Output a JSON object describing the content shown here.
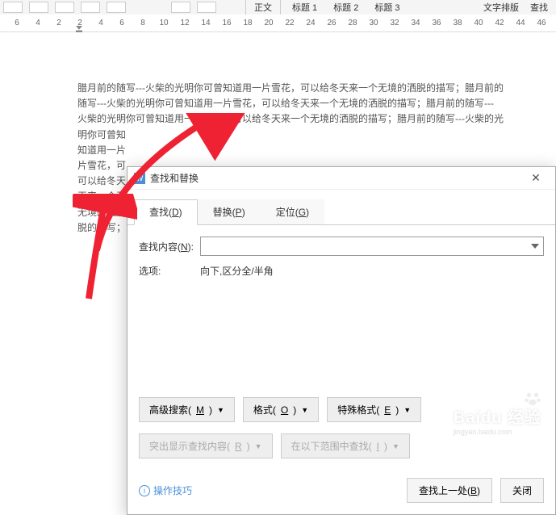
{
  "toolbar": {
    "styles": [
      "正文",
      "标题 1",
      "标题 2",
      "标题 3"
    ],
    "layout": "文字排版",
    "find": "查找"
  },
  "ruler": {
    "ticks": [
      "6",
      "4",
      "2",
      "2",
      "4",
      "6",
      "8",
      "10",
      "12",
      "14",
      "16",
      "18",
      "20",
      "22",
      "24",
      "26",
      "28",
      "30",
      "32",
      "34",
      "36",
      "38",
      "40",
      "42",
      "44",
      "46"
    ]
  },
  "doc": {
    "line1": "腊月前的随写---火柴的光明你可曾知道用一片雪花，可以给冬天来一个无境的洒脱的描写；腊月前的",
    "line2": "随写---火柴的光明你可曾知道用一片雪花，可以给冬天来一个无境的洒脱的描写；腊月前的随写---",
    "line3": "火柴的光明你可曾知道用一片雪花，可以给冬天来一个无境的洒脱的描写；腊月前的随写---火柴的光",
    "line4": "明你可曾知",
    "line5": "知道用一片",
    "line6": "片雪花，可",
    "line7": "可以给冬天",
    "line8": "天来一个无",
    "line9": "无境的洒脱",
    "line10": "脱的描写；"
  },
  "dialog": {
    "title": "查找和替换",
    "tabs": {
      "find": {
        "label": "查找(",
        "key": "D",
        "suffix": ")"
      },
      "replace": {
        "label": "替换(",
        "key": "P",
        "suffix": ")"
      },
      "goto": {
        "label": "定位(",
        "key": "G",
        "suffix": ")"
      }
    },
    "find_label_pre": "查找内容(",
    "find_label_key": "N",
    "find_label_post": "):",
    "find_value": "",
    "options_label": "选项:",
    "options_value": "向下,区分全/半角",
    "adv_search": {
      "label": "高级搜索(",
      "key": "M",
      "suffix": ")"
    },
    "format": {
      "label": "格式(",
      "key": "O",
      "suffix": ")"
    },
    "special": {
      "label": "特殊格式(",
      "key": "E",
      "suffix": ")"
    },
    "highlight": {
      "label": "突出显示查找内容(",
      "key": "R",
      "suffix": ")"
    },
    "find_in": {
      "label": "在以下范围中查找(",
      "key": "I",
      "suffix": ")"
    },
    "help_link": "操作技巧",
    "find_prev": {
      "label": "查找上一处(",
      "key": "B",
      "suffix": ")"
    },
    "close": "关闭"
  },
  "watermark": {
    "main": "Baidu 经验",
    "sub": "jingyan.baidu.com"
  }
}
